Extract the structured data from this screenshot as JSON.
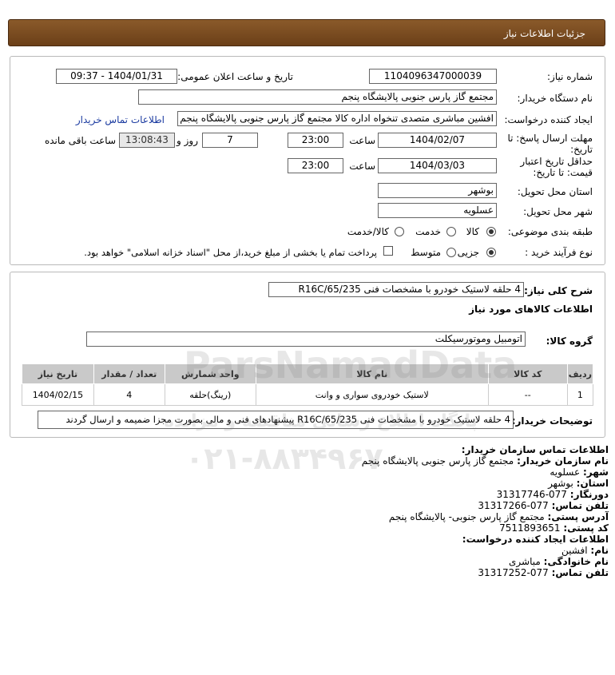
{
  "header": {
    "title": "جزئیات اطلاعات نیاز"
  },
  "form": {
    "need_number_label": "شماره نیاز:",
    "need_number": "1104096347000039",
    "announce_label": "تاریخ و ساعت اعلان عمومی:",
    "announce_value": "1404/01/31 - 09:37",
    "buyer_org_label": "نام دستگاه خریدار:",
    "buyer_org": "مجتمع گاز پارس جنوبی  پالایشگاه پنجم",
    "creator_label": "ایجاد کننده درخواست:",
    "creator": "افشین مباشری متصدی تنخواه اداره کالا مجتمع گاز پارس جنوبی  پالایشگاه پنجم",
    "contact_link": "اطلاعات تماس خریدار",
    "deadline_label_1": "مهلت ارسال پاسخ: تا",
    "deadline_label_2": "تاریخ:",
    "deadline_date": "1404/02/07",
    "time_label": "ساعت",
    "deadline_time": "23:00",
    "days_value": "7",
    "days_label": "روز و",
    "remaining_time": "13:08:43",
    "remaining_label": "ساعت باقی مانده",
    "validity_label_1": "حداقل تاریخ اعتبار",
    "validity_label_2": "قیمت: تا تاریخ:",
    "validity_date": "1404/03/03",
    "validity_time": "23:00",
    "province_label": "استان محل تحویل:",
    "province": "بوشهر",
    "city_label": "شهر محل تحویل:",
    "city": "عسلویه",
    "category_label": "طبقه بندی موضوعی:",
    "category_options": [
      "کالا",
      "خدمت",
      "کالا/خدمت"
    ],
    "process_label": "نوع فرآیند خرید :",
    "process_options": [
      "جزیی",
      "متوسط"
    ],
    "treasury_note": "پرداخت تمام یا بخشی از مبلغ خرید،از محل \"اسناد خزانه اسلامی\" خواهد بود."
  },
  "summary": {
    "desc_label": "شرح کلی نیاز:",
    "desc": "4 حلقه لاستیک خودرو با مشخصات فنی R16C/65/235",
    "goods_info_title": "اطلاعات کالاهای مورد نیاز",
    "group_label": "گروه کالا:",
    "group": "اتومبیل وموتورسیکلت"
  },
  "table": {
    "headers": [
      "ردیف",
      "کد کالا",
      "نام کالا",
      "واحد شمارش",
      "تعداد / مقدار",
      "تاریخ نیاز"
    ],
    "rows": [
      [
        "1",
        "--",
        "لاستیک خودروی سواری و وانت",
        "(رینگ)حلقه",
        "4",
        "1404/02/15"
      ]
    ]
  },
  "buyer_notes": {
    "label": "توضیحات خریدار:",
    "text": "4 حلقه لاستیک خودرو با مشخصات فنی R16C/65/235 پیشنهادهای فنی و مالی بصورت مجزا ضمیمه و ارسال گردند"
  },
  "contact": {
    "title": "اطلاعات تماس سازمان خریدار:",
    "org_label": "نام سازمان خریدار:",
    "org": "مجتمع گاز پارس جنوبی پالایشگاه پنجم",
    "city_label": "شهر:",
    "city": "عسلویه",
    "province_label": "استان:",
    "province": "بوشهر",
    "fax_label": "دورنگار:",
    "fax": "077-31317746",
    "phone_label": "تلفن تماس:",
    "phone": "077-31317266",
    "address_label": "آدرس پستی:",
    "address": "مجتمع گاز پارس جنوبی- پالایشگاه پنجم",
    "postal_label": "کد پستی:",
    "postal": "7511893651",
    "creator_title": "اطلاعات ایجاد کننده درخواست:",
    "name_label": "نام:",
    "name": "افشین",
    "family_label": "نام خانوادگی:",
    "family": "مباشری",
    "creator_phone_label": "تلفن تماس:",
    "creator_phone": "077-31317252"
  },
  "watermark": {
    "line1": "ParsNamadData",
    "line2": "پایگاه اطلاع رسانی مناقصه و مزایده",
    "phone": "۰۲۱-۸۸۳۴۹۶۷۰"
  },
  "colors": {
    "header_bg": "#6b3f18",
    "link": "#1a3aa0",
    "table_header": "#c9c9c9"
  }
}
